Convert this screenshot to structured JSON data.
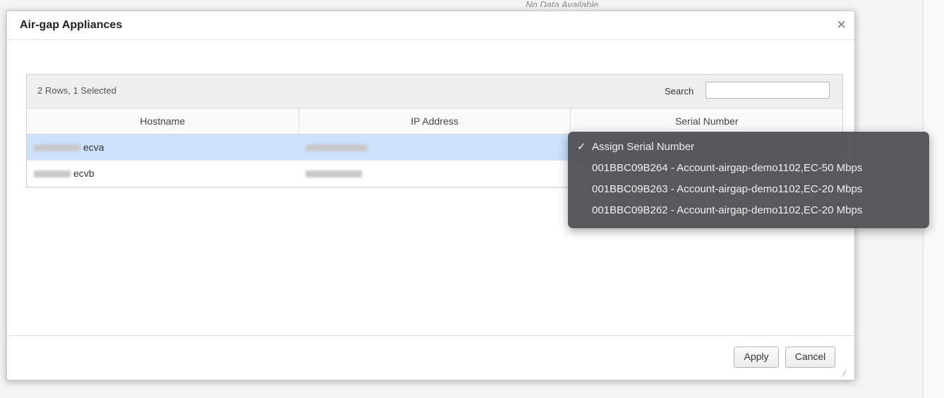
{
  "background": {
    "no_data_text": "No Data Available"
  },
  "dialog": {
    "title": "Air-gap Appliances",
    "close_symbol": "×",
    "grid": {
      "row_summary": "2 Rows, 1 Selected",
      "search_label": "Search",
      "search_value": "",
      "columns": [
        "Hostname",
        "IP Address",
        "Serial Number"
      ],
      "rows": [
        {
          "hostname": "ecva",
          "ip": "",
          "serial": "",
          "selected": true
        },
        {
          "hostname": "ecvb",
          "ip": "",
          "serial": "",
          "selected": false
        }
      ]
    },
    "footer": {
      "apply_label": "Apply",
      "cancel_label": "Cancel"
    }
  },
  "serial_dropdown": {
    "check_symbol": "✓",
    "selected_index": 0,
    "options": [
      "Assign Serial Number",
      "001BBC09B264 - Account-airgap-demo1102,EC-50 Mbps",
      "001BBC09B263 - Account-airgap-demo1102,EC-20 Mbps",
      "001BBC09B262 - Account-airgap-demo1102,EC-20 Mbps"
    ]
  },
  "colors": {
    "selected_row": "#cde1fb",
    "dropdown_bg": "#525256"
  }
}
